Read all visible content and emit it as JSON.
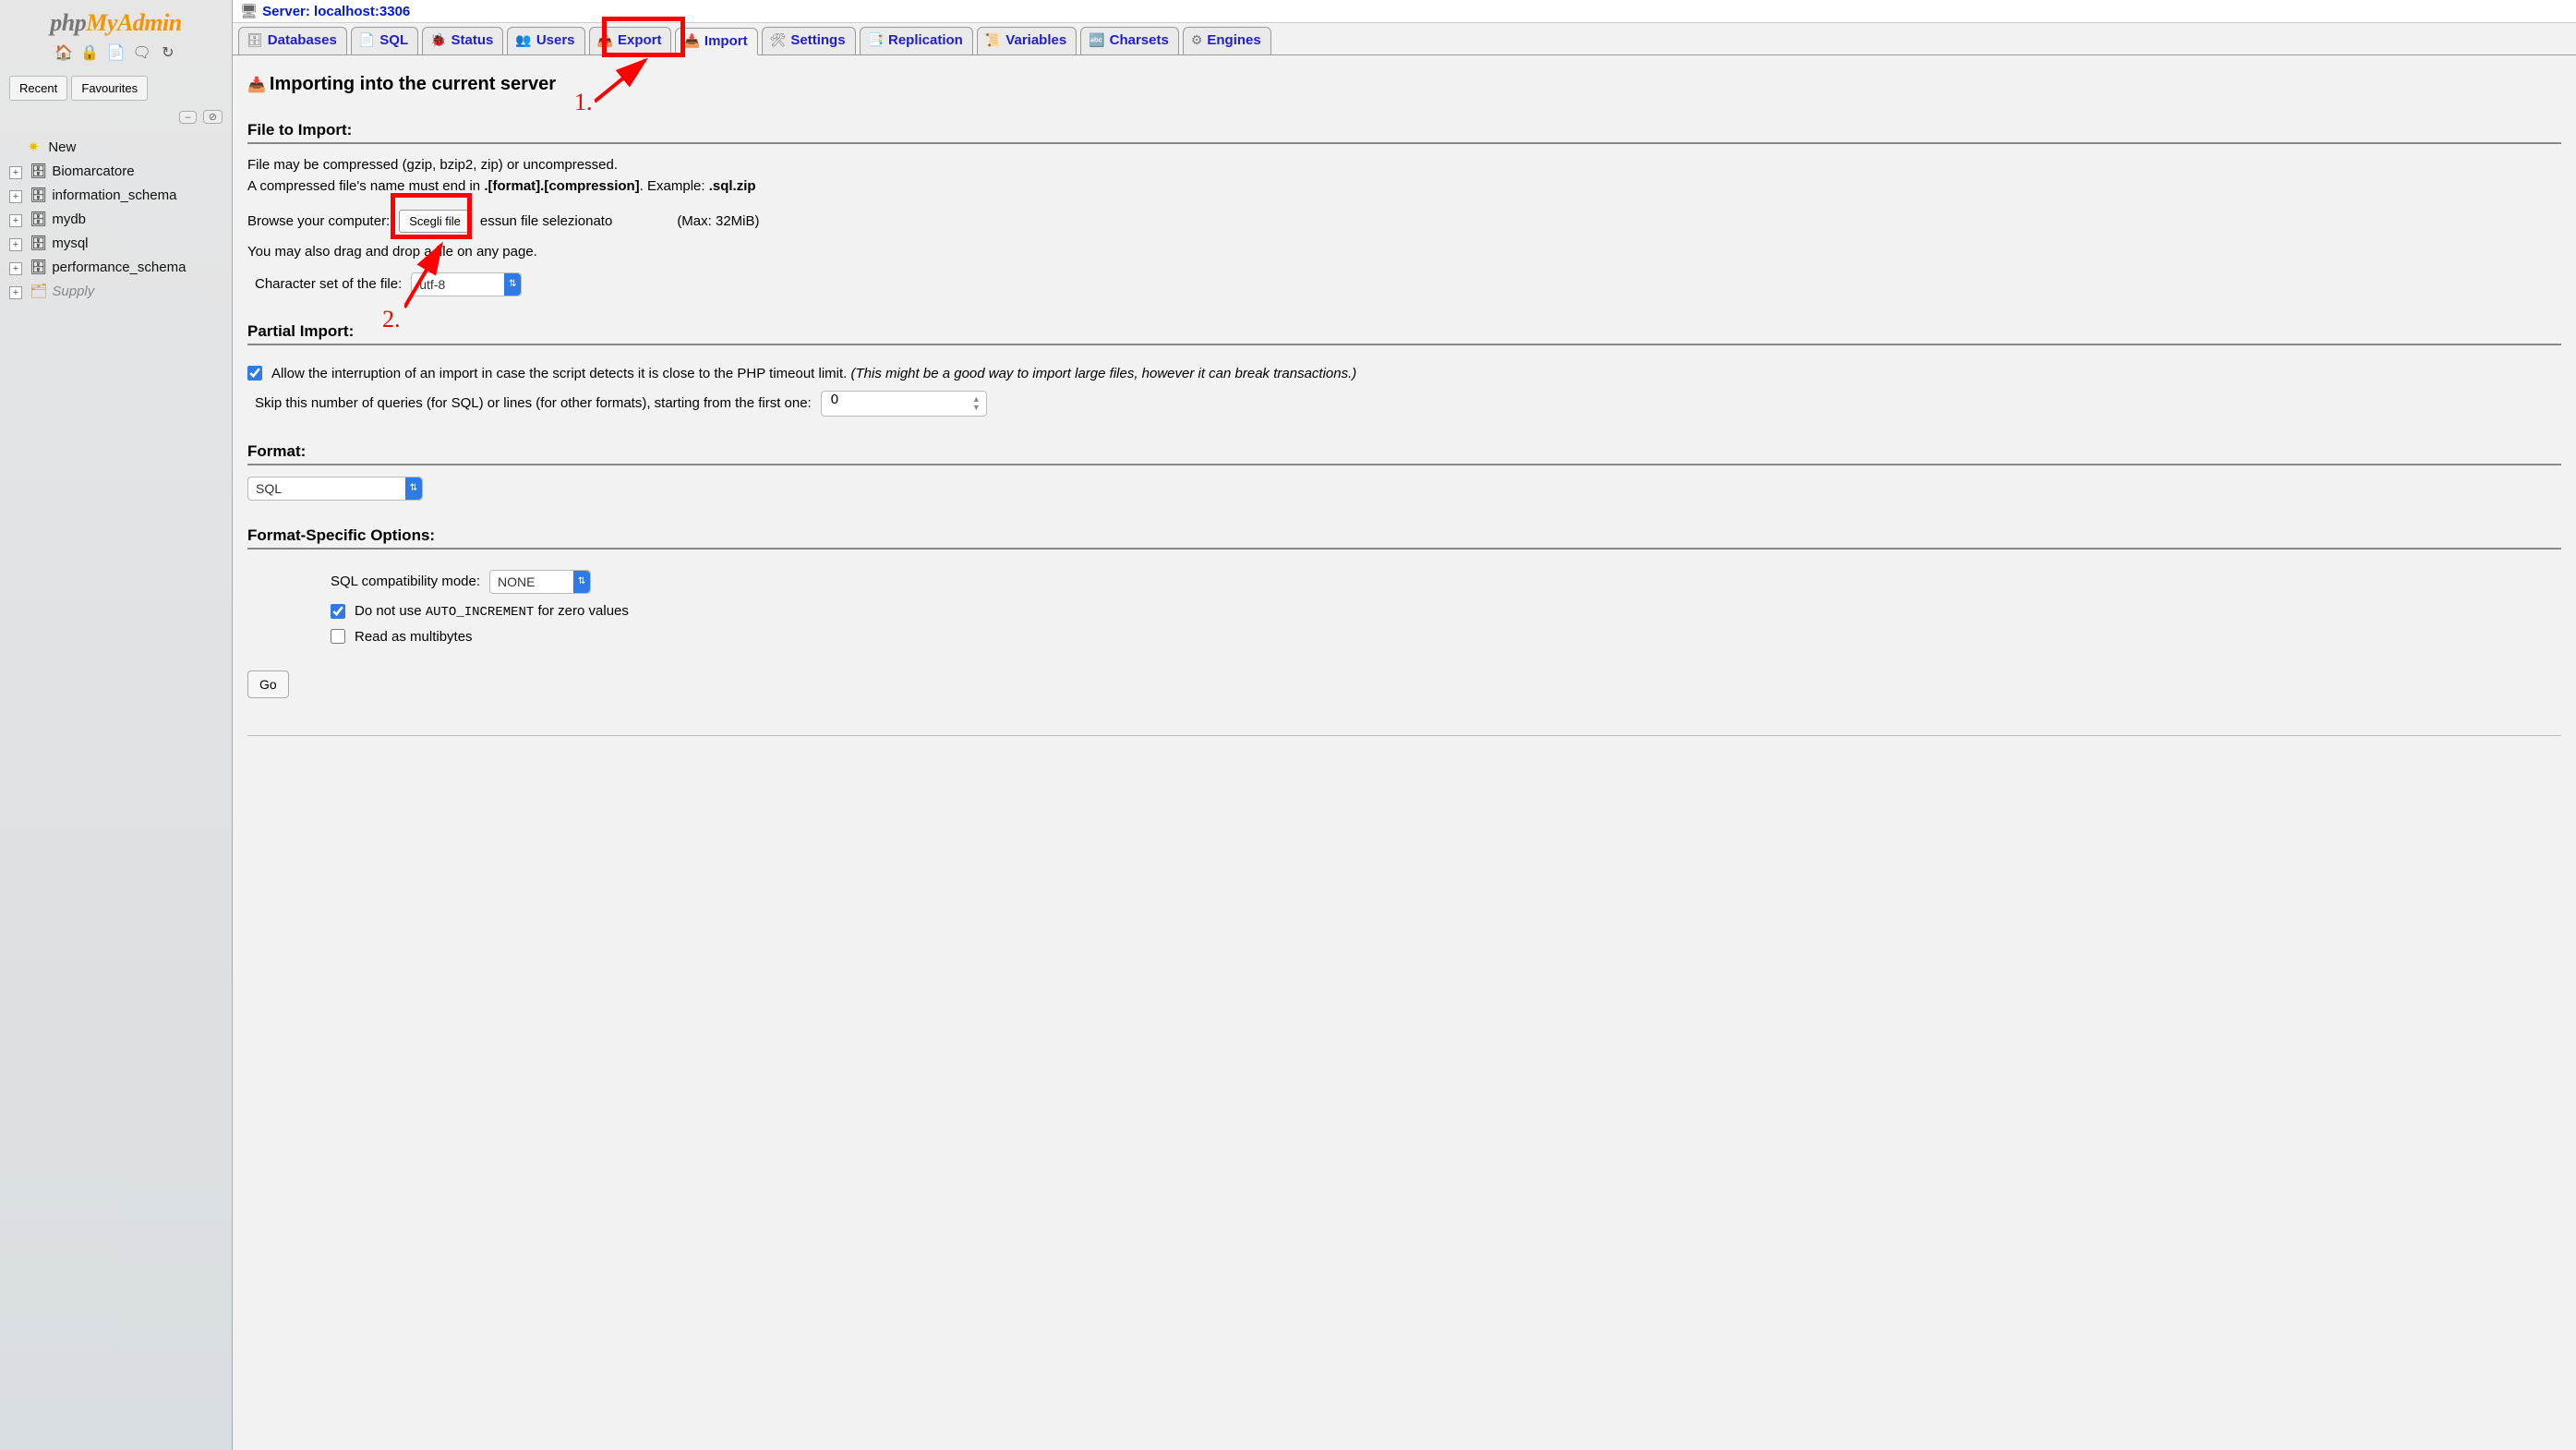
{
  "logo": {
    "php": "php",
    "my": "My",
    "admin": "Admin"
  },
  "sidebar": {
    "recent": "Recent",
    "favourites": "Favourites",
    "collapse1": "–",
    "collapse2": "⊘",
    "items": [
      {
        "label": "New",
        "cls": "new"
      },
      {
        "label": "Biomarcatore",
        "cls": ""
      },
      {
        "label": "information_schema",
        "cls": ""
      },
      {
        "label": "mydb",
        "cls": ""
      },
      {
        "label": "mysql",
        "cls": ""
      },
      {
        "label": "performance_schema",
        "cls": ""
      },
      {
        "label": "Supply",
        "cls": "supply"
      }
    ]
  },
  "server": {
    "icon": "🖥",
    "label": "Server: localhost:3306"
  },
  "tabs": [
    {
      "icon": "🗄",
      "label": "Databases"
    },
    {
      "icon": "📄",
      "label": "SQL"
    },
    {
      "icon": "🐞",
      "label": "Status"
    },
    {
      "icon": "👥",
      "label": "Users"
    },
    {
      "icon": "📤",
      "label": "Export"
    },
    {
      "icon": "📥",
      "label": "Import"
    },
    {
      "icon": "🛠",
      "label": "Settings"
    },
    {
      "icon": "📑",
      "label": "Replication"
    },
    {
      "icon": "📜",
      "label": "Variables"
    },
    {
      "icon": "🔤",
      "label": "Charsets"
    },
    {
      "icon": "⚙",
      "label": "Engines"
    }
  ],
  "page": {
    "title": "Importing into the current server",
    "sections": {
      "fileImport": {
        "head": "File to Import:",
        "l1": "File may be compressed (gzip, bzip2, zip) or uncompressed.",
        "l2a": "A compressed file's name must end in ",
        "l2b": ".[format].[compression]",
        "l2c": ". Example: ",
        "l2d": ".sql.zip",
        "browseLabel": "Browse your computer:",
        "chooseBtn": "Scegli file",
        "noFile": "essun file selezionato",
        "maxLabel": "(Max: 32MiB)",
        "dragLine": "You may also drag and drop a file on any page.",
        "charsetLabel": "Character set of the file:",
        "charsetSelected": "utf-8"
      },
      "partial": {
        "head": "Partial Import:",
        "allowText": "Allow the interruption of an import in case the script detects it is close to the PHP timeout limit. ",
        "allowNote": "(This might be a good way to import large files, however it can break transactions.)",
        "skipLabel": "Skip this number of queries (for SQL) or lines (for other formats), starting from the first one:",
        "skipValue": "0"
      },
      "format": {
        "head": "Format:",
        "selected": "SQL"
      },
      "options": {
        "head": "Format-Specific Options:",
        "compatLabel": "SQL compatibility mode:",
        "compatSelected": "NONE",
        "aiLabel1": "Do not use ",
        "aiCode": "AUTO_INCREMENT",
        "aiLabel2": " for zero values",
        "multiLabel": "Read as multibytes"
      }
    },
    "go": "Go"
  },
  "annotations": {
    "one": "1.",
    "two": "2."
  }
}
